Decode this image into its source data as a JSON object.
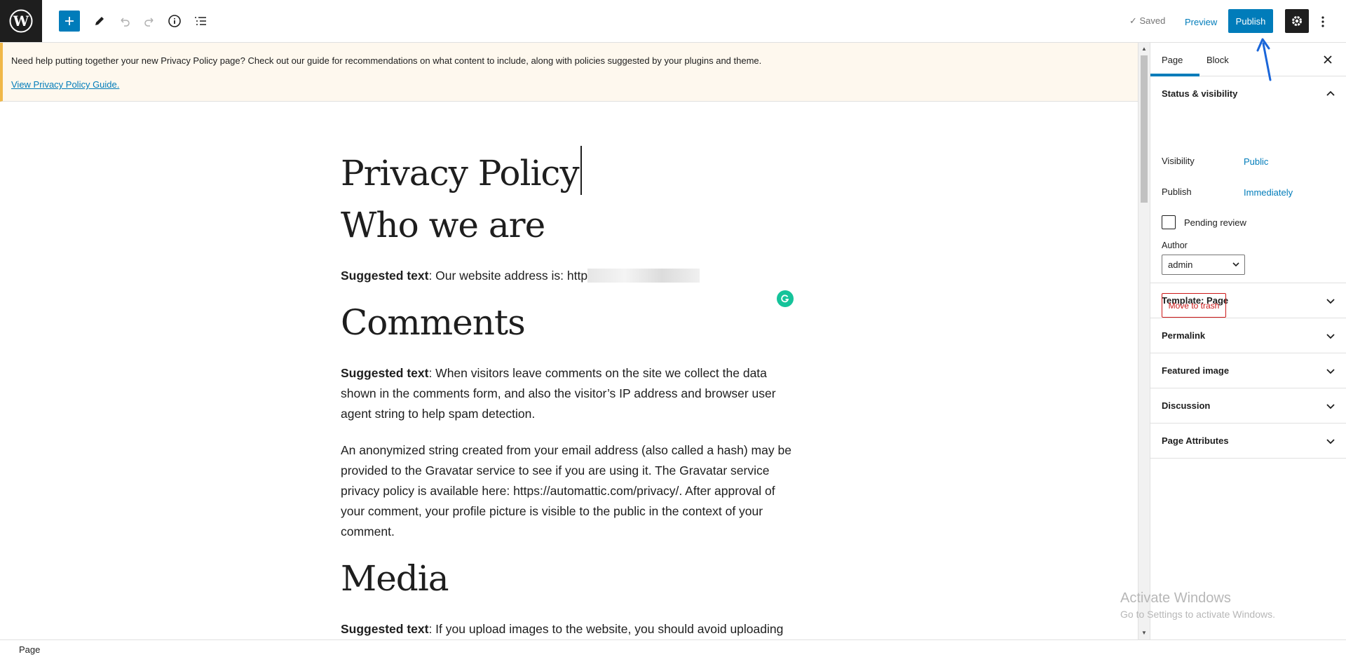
{
  "toolbar": {
    "saved_label": "Saved",
    "preview_label": "Preview",
    "publish_label": "Publish"
  },
  "notice": {
    "text": "Need help putting together your new Privacy Policy page? Check out our guide for recommendations on what content to include, along with policies suggested by your plugins and theme.",
    "link": "View Privacy Policy Guide."
  },
  "content": {
    "title": "Privacy Policy",
    "sections": [
      {
        "heading": "Who we are",
        "bold": "Suggested text",
        "text": ": Our website address is: http"
      },
      {
        "heading": "Comments",
        "bold": "Suggested text",
        "text": ": When visitors leave comments on the site we collect the data shown in the comments form, and also the visitor’s IP address and browser user agent string to help spam detection.",
        "extra": "An anonymized string created from your email address (also called a hash) may be provided to the Gravatar service to see if you are using it. The Gravatar service privacy policy is available here: https://automattic.com/privacy/. After approval of your comment, your profile picture is visible to the public in the context of your comment."
      },
      {
        "heading": "Media",
        "bold": "Suggested text",
        "text": ": If you upload images to the website, you should avoid uploading"
      }
    ]
  },
  "sidebar": {
    "tabs": [
      "Page",
      "Block"
    ],
    "status_visibility": {
      "title": "Status & visibility",
      "visibility_label": "Visibility",
      "visibility_value": "Public",
      "publish_label": "Publish",
      "publish_value": "Immediately",
      "pending_label": "Pending review",
      "author_label": "Author",
      "author_value": "admin",
      "trash_label": "Move to trash"
    },
    "panels": [
      "Template: Page",
      "Permalink",
      "Featured image",
      "Discussion",
      "Page Attributes"
    ]
  },
  "watermark": {
    "title": "Activate Windows",
    "subtitle": "Go to Settings to activate Windows."
  },
  "footer": {
    "breadcrumb": "Page"
  },
  "colors": {
    "accent": "#007cba",
    "danger": "#cc1818",
    "notice_bg": "#fef8ee",
    "notice_border": "#f0b849",
    "grammarly": "#15c39a"
  }
}
